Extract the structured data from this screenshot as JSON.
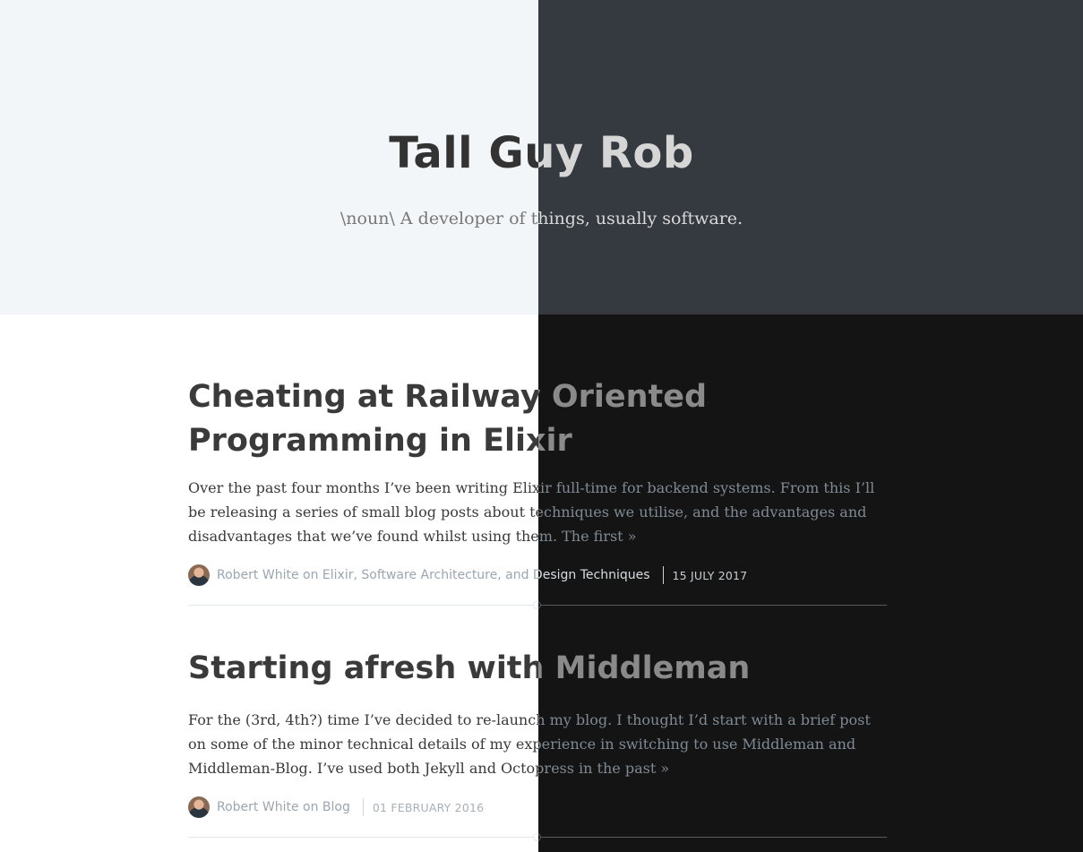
{
  "header": {
    "title": "Tall Guy Rob",
    "tagline": "\\noun\\ A developer of things, usually software."
  },
  "posts": [
    {
      "title": "Cheating at Railway Oriented Programming in Elixir",
      "excerpt": "Over the past four months I’ve been writing Elixir full-time for backend systems. From this I’ll be releasing a series of small blog posts about techniques we utilise, and the advantages and disadvantages that we’ve found whilst using them. The first ",
      "read_more": "»",
      "byline": "Robert White on Elixir, Software Architecture, and Design Techniques",
      "date": "15 July 2017"
    },
    {
      "title": "Starting afresh with Middleman",
      "excerpt": "For the (3rd, 4th?) time I’ve decided to re-launch my blog. I thought I’d start with a brief post on some of the minor technical details of my experience in switching to use Middleman and Middleman-Blog. I’ve used both Jekyll and Octopress in the past ",
      "read_more": "»",
      "byline": "Robert White on Blog",
      "date": "01 February 2016"
    }
  ],
  "colors": {
    "light_header_bg": "#f3f6f9",
    "dark_header_bg": "#353a40",
    "light_body_bg": "#ffffff",
    "dark_body_bg": "#141414"
  }
}
